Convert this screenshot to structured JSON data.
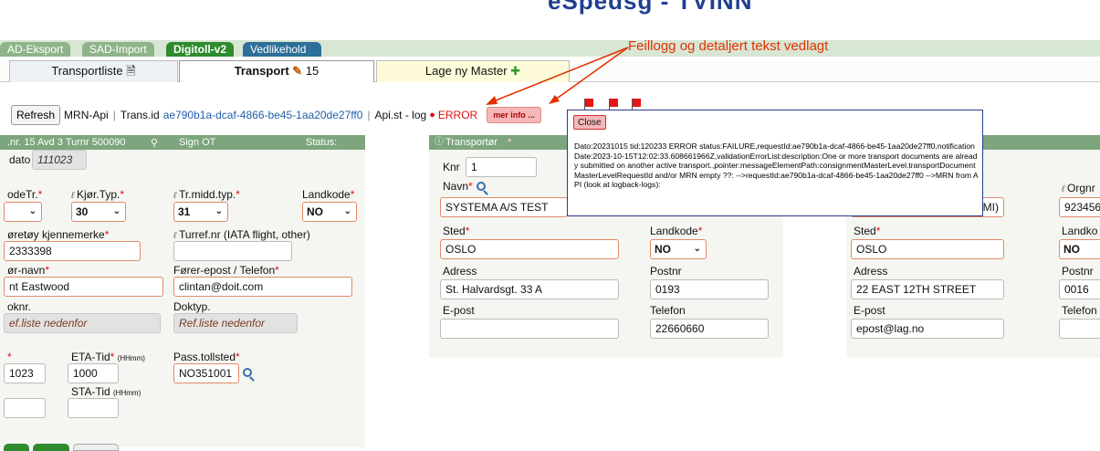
{
  "app": {
    "title": "eSpedsg - TVINN"
  },
  "module_tabs": [
    "AD-Eksport",
    "SAD-Import",
    "Digitoll-v2",
    "Vedlikehold"
  ],
  "sub_tabs": [
    {
      "label": "Transportliste",
      "icon": "document-icon"
    },
    {
      "label": "Transport",
      "icon": "pencil-icon",
      "count": "15"
    },
    {
      "label": "Lage ny Master",
      "icon": "plus-circle-icon"
    }
  ],
  "annotation": "Feillogg og detaljert tekst vedlagt",
  "toolbar": {
    "refresh": "Refresh",
    "mrn_api": "MRN-Api",
    "trans_id_label": "Trans.id",
    "trans_id": "ae790b1a-dcaf-4866-be45-1aa20de27ff0",
    "api_status": "Api.st - log",
    "error": "ERROR",
    "mer_info": "mer info ..."
  },
  "left_panel": {
    "header": ".nr. 15  Avd 3  Turnr 500090",
    "sign": "Sign OT",
    "status": "Status:",
    "dato_label": "dato",
    "dato": "111023",
    "kodetr_label": "odeTr.",
    "kjortyp_label": "Kjør.Typ.",
    "kjortyp": "30",
    "trmidd_label": "Tr.midd.typ.",
    "trmidd": "31",
    "landkode_label": "Landkode",
    "landkode": "NO",
    "kjennemerke_label": "øretøy kjennemerke",
    "kjennemerke": "2333398",
    "turref_label": "Turref.nr (IATA flight, other)",
    "forer_navn_label": "ør-navn",
    "forer_navn": "nt Eastwood",
    "forer_epost_label": "Fører-epost / Telefon",
    "forer_epost": "clintan@doit.com",
    "doknr_label": "oknr.",
    "doknr": "ef.liste nedenfor",
    "doktyp_label": "Doktyp.",
    "doktyp": "Ref.liste nedenfor",
    "eta_date": "1023",
    "eta_tid_label": "ETA-Tid",
    "eta_tid_fmt": "(HHmm)",
    "eta_tid": "1000",
    "pass_label": "Pass.tollsted",
    "pass": "NO351001",
    "sta_tid_label": "STA-Tid",
    "sta_tid_fmt": "(HHmm)"
  },
  "transporter": {
    "header": "Transportør",
    "knr_label": "Knr",
    "knr": "1",
    "navn_label": "Navn",
    "navn": "SYSTEMA A/S  TEST",
    "sted_label": "Sted",
    "sted": "OSLO",
    "landkode_label": "Landkode",
    "landkode": "NO",
    "adress_label": "Adress",
    "adress": "St. Halvardsgt. 33 A",
    "postnr_label": "Postnr",
    "postnr": "0193",
    "epost_label": "E-post",
    "telefon_label": "Telefon",
    "telefon": "22660660"
  },
  "right_panel": {
    "orgnr_label": "Orgnr",
    "orgnr": "923456",
    "name_suffix": "MI)",
    "sted_label": "Sted",
    "sted": "OSLO",
    "landkode_label": "Landko",
    "landkode": "NO",
    "adress_label": "Adress",
    "adress": "22 EAST 12TH STREET",
    "postnr_label": "Postnr",
    "postnr": "0016",
    "epost_label": "E-post",
    "epost": "epost@lag.no",
    "telefon_label": "Telefon"
  },
  "popup": {
    "close": "Close",
    "text": "Dato:20231015 tid:120233 ERROR status:FAILURE,requestId:ae790b1a-dcaf-4866-be45-1aa20de27ff0,notificationDate:2023-10-15T12:02:33.608661966Z,validationErrorList:description:One or more transport documents are already submitted on another active transport.,pointer:messageElementPath:consignmentMasterLevel.transportDocumentMasterLevelRequestId and/or MRN empty ??: -->requestId:ae790b1a-dcaf-4866-be45-1aa20de27ff0 -->MRN from API (look at logback-logs):"
  },
  "colors": {
    "accent_green": "#7ea67e",
    "error_red": "#d11111",
    "annotation": "#e23200"
  }
}
